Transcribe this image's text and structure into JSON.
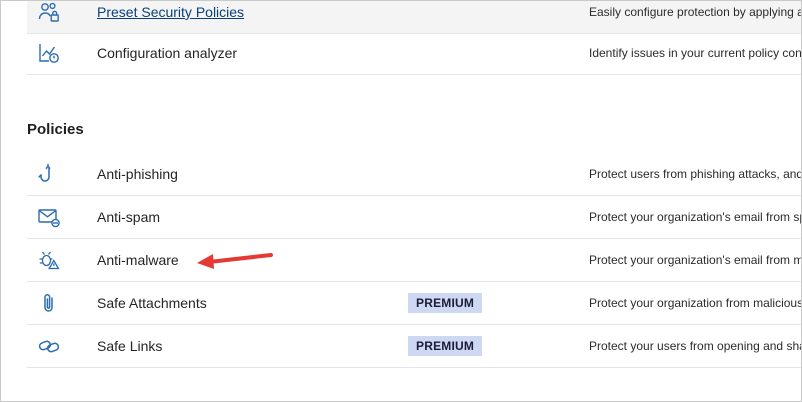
{
  "top_items": [
    {
      "name": "Preset Security Policies",
      "description": "Easily configure protection by applying a",
      "icon": "people-lock-icon",
      "is_link": true
    },
    {
      "name": "Configuration analyzer",
      "description": "Identify issues in your current policy con",
      "icon": "chart-check-icon",
      "is_link": false
    }
  ],
  "policies": {
    "title": "Policies",
    "items": [
      {
        "name": "Anti-phishing",
        "description": "Protect users from phishing attacks, and",
        "icon": "fishhook-icon"
      },
      {
        "name": "Anti-spam",
        "description": "Protect your organization's email from sp",
        "icon": "mail-block-icon"
      },
      {
        "name": "Anti-malware",
        "description": "Protect your organization's email from m",
        "icon": "bug-warning-icon"
      },
      {
        "name": "Safe Attachments",
        "badge": "PREMIUM",
        "description": "Protect your organization from malicious",
        "icon": "paperclip-icon"
      },
      {
        "name": "Safe Links",
        "badge": "PREMIUM",
        "description": "Protect your users from opening and sha",
        "icon": "link-icon"
      }
    ]
  },
  "annotation": {
    "arrow_color": "#e53935",
    "icon": "red-arrow-icon"
  },
  "colors": {
    "icon": "#2b6cb0",
    "badge_bg": "#cfd8f3",
    "link": "#0a3f7a"
  }
}
